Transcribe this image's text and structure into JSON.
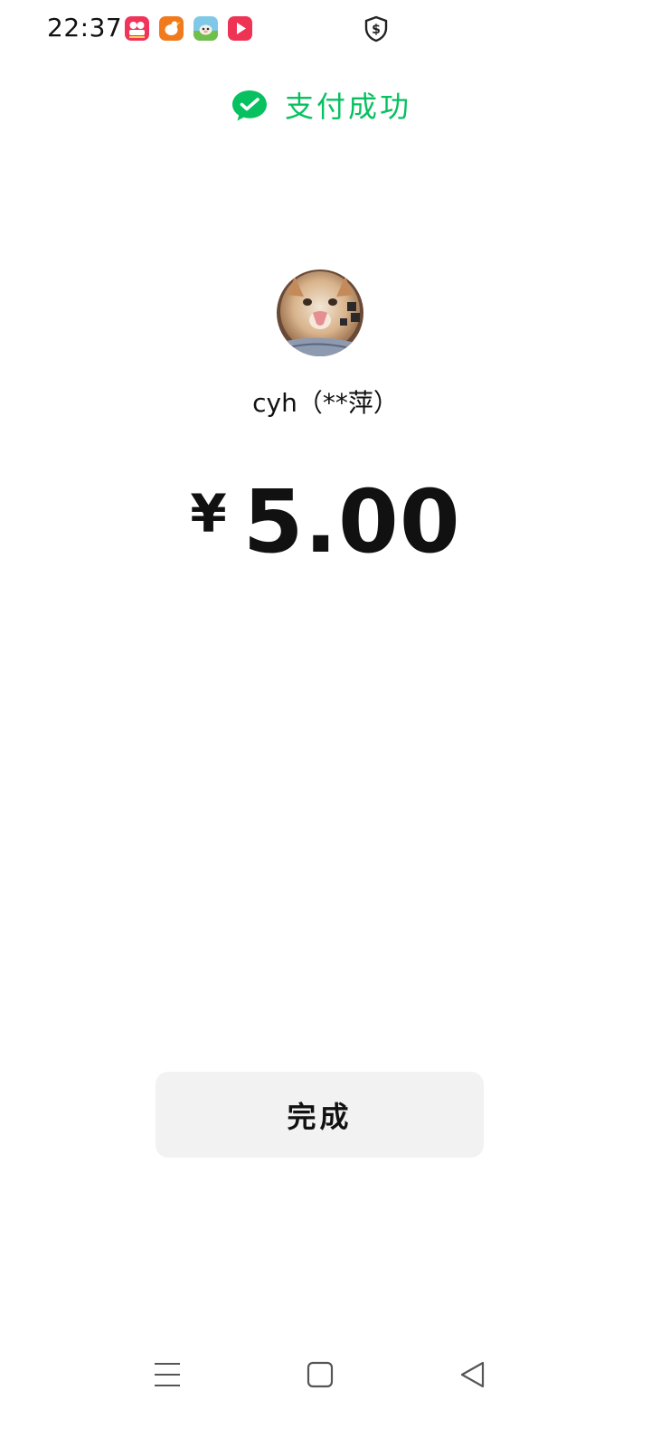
{
  "status_bar": {
    "time": "22:37",
    "notification_icons": [
      "app-icon-pink",
      "app-icon-orange",
      "app-icon-game",
      "app-icon-video"
    ],
    "status_icon": "shield-dollar-icon"
  },
  "header": {
    "icon": "wechat-pay-icon",
    "title": "支付成功",
    "accent_color": "#07c160"
  },
  "payee": {
    "avatar": "cat-avatar",
    "name": "cyh（**萍）"
  },
  "payment": {
    "currency_symbol": "¥",
    "amount": "5.00"
  },
  "actions": {
    "done_label": "完成"
  },
  "navigation": {
    "items": [
      "menu-icon",
      "home-icon",
      "back-icon"
    ]
  }
}
